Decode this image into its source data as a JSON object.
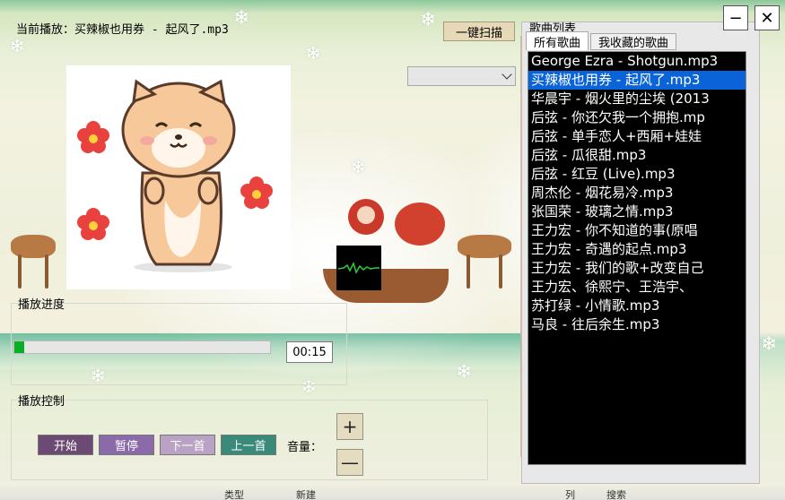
{
  "header": {
    "now_playing": "当前播放：买辣椒也用券 - 起风了.mp3",
    "scan_label": "一键扫描"
  },
  "progress": {
    "group_label": "播放进度",
    "time": "00:15",
    "fraction": 0.04
  },
  "controls": {
    "group_label": "播放控制",
    "play_label": "开始",
    "pause_label": "暂停",
    "next_label": "下一首",
    "prev_label": "上一首",
    "volume_label": "音量：",
    "volume_up": "+",
    "volume_down": "—"
  },
  "playlist": {
    "title": "歌曲列表",
    "tab_all": "所有歌曲",
    "tab_fav": "我收藏的歌曲",
    "selected_index": 1,
    "songs": [
      "George Ezra - Shotgun.mp3",
      "买辣椒也用券 - 起风了.mp3",
      "华晨宇 - 烟火里的尘埃 (2013",
      "后弦 - 你还欠我一个拥抱.mp",
      "后弦 - 单手恋人+西厢+娃娃",
      "后弦 - 瓜很甜.mp3",
      "后弦 - 红豆 (Live).mp3",
      "周杰伦 - 烟花易冷.mp3",
      "张国荣 - 玻璃之情.mp3",
      "王力宏 - 你不知道的事(原唱",
      "王力宏 - 奇遇的起点.mp3",
      "王力宏 - 我们的歌+改变自己",
      "王力宏、徐熙宁、王浩宇、",
      "苏打绿 - 小情歌.mp3",
      "马良 - 往后余生.mp3"
    ]
  },
  "window": {
    "minimize": "−",
    "close": "✕"
  },
  "taskbar": {
    "items": [
      "类型",
      "新建",
      "列",
      "搜索"
    ]
  },
  "colors": {
    "progress_fill": "#06b025",
    "selection": "#0a64d8",
    "play_btn": "#6b4a73",
    "pause_btn": "#8a6aa8",
    "next_btn": "#b9a2c4",
    "prev_btn": "#3a8a7a"
  },
  "icons": {
    "album_art": "cat-sticker-icon",
    "visualizer": "waveform-icon"
  }
}
